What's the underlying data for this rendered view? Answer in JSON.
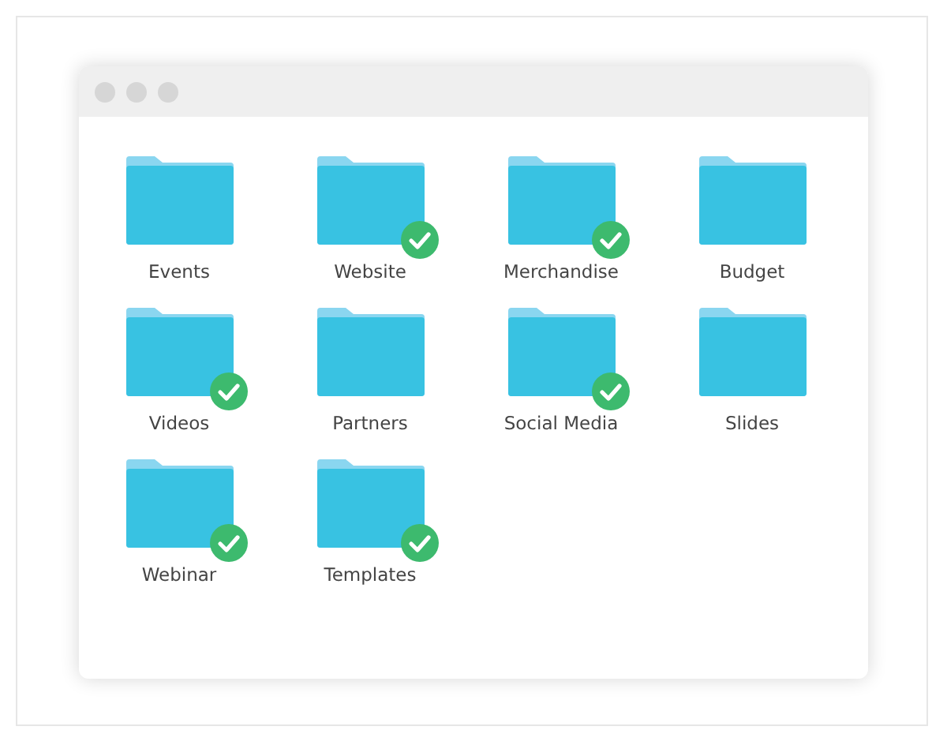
{
  "folders": [
    {
      "name": "Events",
      "checked": false
    },
    {
      "name": "Website",
      "checked": true
    },
    {
      "name": "Merchandise",
      "checked": true
    },
    {
      "name": "Budget",
      "checked": false
    },
    {
      "name": "Videos",
      "checked": true
    },
    {
      "name": "Partners",
      "checked": false
    },
    {
      "name": "Social Media",
      "checked": true
    },
    {
      "name": "Slides",
      "checked": false
    },
    {
      "name": "Webinar",
      "checked": true
    },
    {
      "name": "Templates",
      "checked": true
    }
  ]
}
